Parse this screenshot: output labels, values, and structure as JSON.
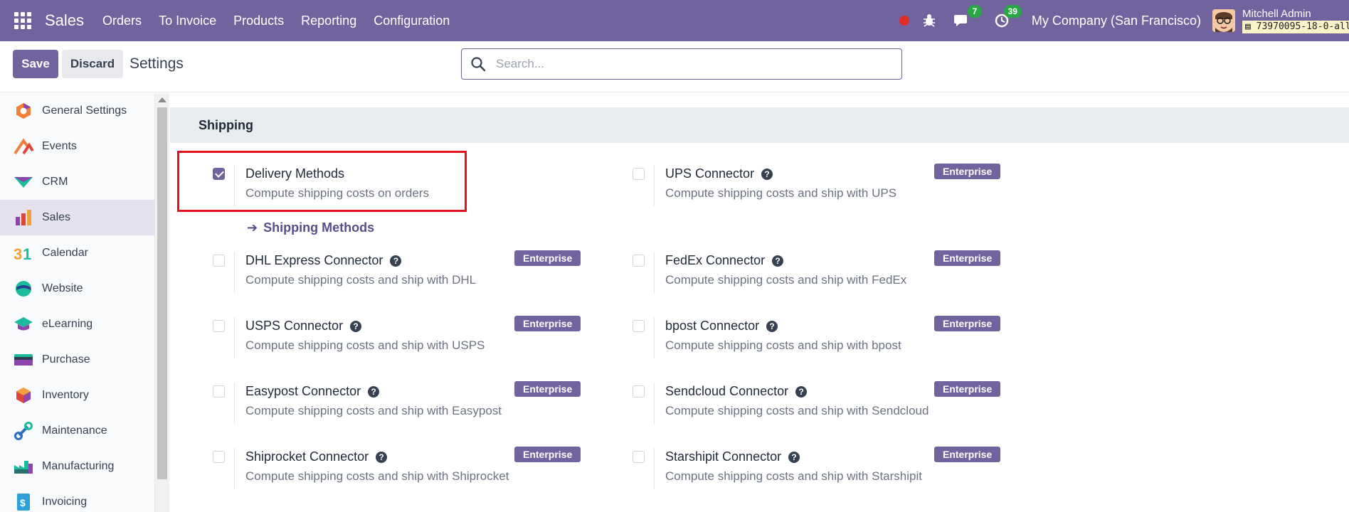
{
  "navbar": {
    "brand": "Sales",
    "menu": [
      "Orders",
      "To Invoice",
      "Products",
      "Reporting",
      "Configuration"
    ],
    "messages_count": "7",
    "activities_count": "39",
    "company": "My Company (San Francisco)",
    "user_name": "Mitchell Admin",
    "db_name": "73970095-18-0-all"
  },
  "control": {
    "save_label": "Save",
    "discard_label": "Discard",
    "title": "Settings",
    "search_placeholder": "Search..."
  },
  "sidebar": {
    "items": [
      {
        "label": "General Settings",
        "icon": "general-settings-icon"
      },
      {
        "label": "Events",
        "icon": "events-icon"
      },
      {
        "label": "CRM",
        "icon": "crm-icon"
      },
      {
        "label": "Sales",
        "icon": "sales-icon",
        "active": true
      },
      {
        "label": "Calendar",
        "icon": "calendar-icon"
      },
      {
        "label": "Website",
        "icon": "website-icon"
      },
      {
        "label": "eLearning",
        "icon": "elearning-icon"
      },
      {
        "label": "Purchase",
        "icon": "purchase-icon"
      },
      {
        "label": "Inventory",
        "icon": "inventory-icon"
      },
      {
        "label": "Maintenance",
        "icon": "maintenance-icon"
      },
      {
        "label": "Manufacturing",
        "icon": "manufacturing-icon"
      },
      {
        "label": "Invoicing",
        "icon": "invoicing-icon"
      }
    ]
  },
  "main": {
    "section_title": "Shipping",
    "enterprise_label": "Enterprise",
    "shipping_methods_link": "Shipping Methods",
    "settings": [
      {
        "title": "Delivery Methods",
        "desc": "Compute shipping costs on orders",
        "checked": true,
        "help": false,
        "enterprise": false
      },
      {
        "title": "UPS Connector",
        "desc": "Compute shipping costs and ship with UPS",
        "checked": false,
        "help": true,
        "enterprise": true
      },
      {
        "title": "DHL Express Connector",
        "desc": "Compute shipping costs and ship with DHL",
        "checked": false,
        "help": true,
        "enterprise": true
      },
      {
        "title": "FedEx Connector",
        "desc": "Compute shipping costs and ship with FedEx",
        "checked": false,
        "help": true,
        "enterprise": true
      },
      {
        "title": "USPS Connector",
        "desc": "Compute shipping costs and ship with USPS",
        "checked": false,
        "help": true,
        "enterprise": true
      },
      {
        "title": "bpost Connector",
        "desc": "Compute shipping costs and ship with bpost",
        "checked": false,
        "help": true,
        "enterprise": true
      },
      {
        "title": "Easypost Connector",
        "desc": "Compute shipping costs and ship with Easypost",
        "checked": false,
        "help": true,
        "enterprise": true
      },
      {
        "title": "Sendcloud Connector",
        "desc": "Compute shipping costs and ship with Sendcloud",
        "checked": false,
        "help": true,
        "enterprise": true
      },
      {
        "title": "Shiprocket Connector",
        "desc": "Compute shipping costs and ship with Shiprocket",
        "checked": false,
        "help": true,
        "enterprise": true
      },
      {
        "title": "Starshipit Connector",
        "desc": "Compute shipping costs and ship with Starshipit",
        "checked": false,
        "help": true,
        "enterprise": true
      }
    ]
  },
  "colors": {
    "brand": "#71639e",
    "highlight": "#e0121a",
    "badge_green": "#28a745"
  }
}
